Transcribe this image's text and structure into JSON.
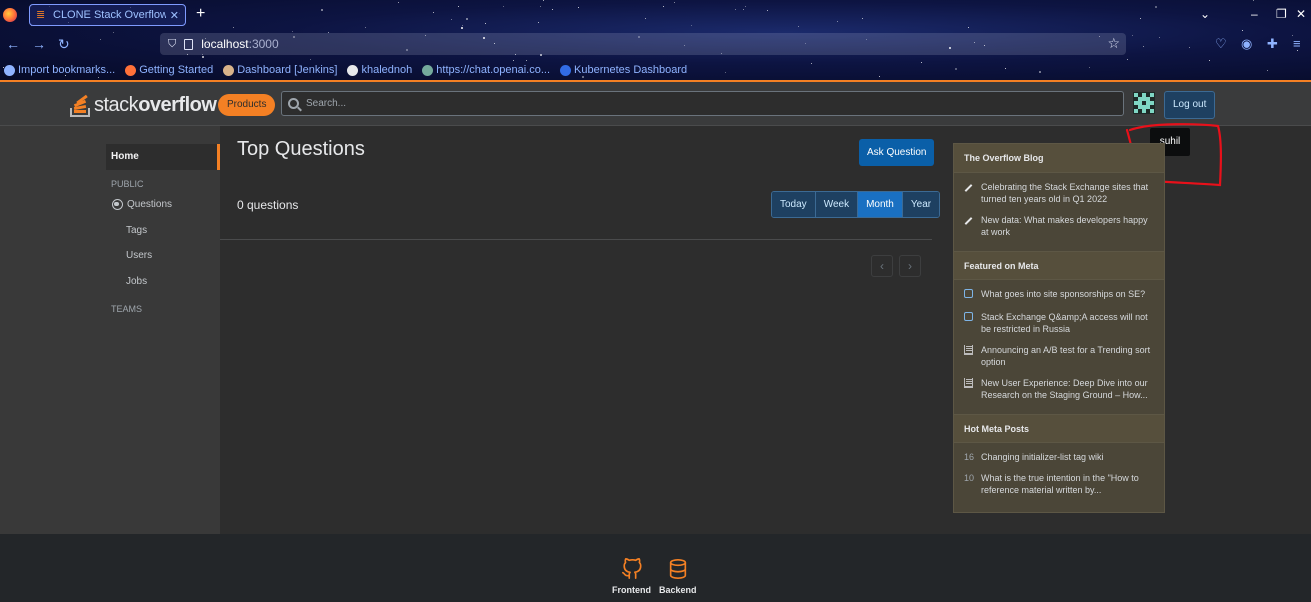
{
  "browser": {
    "tab_title": "CLONE Stack Overflow -",
    "tab_close": "✕",
    "new_tab": "+",
    "url_host": "localhost",
    "url_port": ":3000",
    "bookmarks": [
      {
        "label": "Import bookmarks...",
        "color": "#8fb3ff"
      },
      {
        "label": "Getting Started",
        "color": "#ff7139"
      },
      {
        "label": "Dashboard [Jenkins]",
        "color": "#d8b38a"
      },
      {
        "label": "khalednoh",
        "color": "#e7e8ea"
      },
      {
        "label": "https://chat.openai.co...",
        "color": "#74aa9c"
      },
      {
        "label": "Kubernetes Dashboard",
        "color": "#326ce5"
      }
    ]
  },
  "topbar": {
    "logo_light": "stack",
    "logo_bold": "overflow",
    "products": "Products",
    "search_placeholder": "Search...",
    "logout": "Log out",
    "tooltip": "suhil"
  },
  "sidebar": {
    "home": "Home",
    "public": "PUBLIC",
    "questions": "Questions",
    "tags": "Tags",
    "users": "Users",
    "jobs": "Jobs",
    "teams": "TEAMS"
  },
  "main": {
    "title": "Top Questions",
    "ask": "Ask Question",
    "count": "0 questions",
    "filters": [
      "Today",
      "Week",
      "Month",
      "Year"
    ],
    "active_filter": "Month",
    "prev": "‹",
    "next": "›"
  },
  "widget": {
    "blog_head": "The Overflow Blog",
    "blog": [
      "Celebrating the Stack Exchange sites that turned ten years old in Q1 2022",
      "New data: What makes developers happy at work"
    ],
    "meta_head": "Featured on Meta",
    "meta": [
      {
        "icon": "chat-bubble-icon",
        "text": "What goes into site sponsorships on SE?"
      },
      {
        "icon": "chat-bubble-icon",
        "text": "Stack Exchange Q&amp;A access will not be restricted in Russia"
      },
      {
        "icon": "stack-icon",
        "text": "Announcing an A/B test for a Trending sort option"
      },
      {
        "icon": "stack-icon",
        "text": "New User Experience: Deep Dive into our Research on the Staging Ground – How..."
      }
    ],
    "hot_head": "Hot Meta Posts",
    "hot": [
      {
        "num": "16",
        "text": "Changing initializer-list tag wiki"
      },
      {
        "num": "10",
        "text": "What is the true intention in the \"How to reference material written by..."
      }
    ]
  },
  "footer": {
    "frontend": "Frontend",
    "backend": "Backend"
  },
  "colors": {
    "accent": "#f48024",
    "link_blue": "#0a5fa8",
    "widget_bg": "#4b4638",
    "annotation_red": "#e8101a"
  }
}
